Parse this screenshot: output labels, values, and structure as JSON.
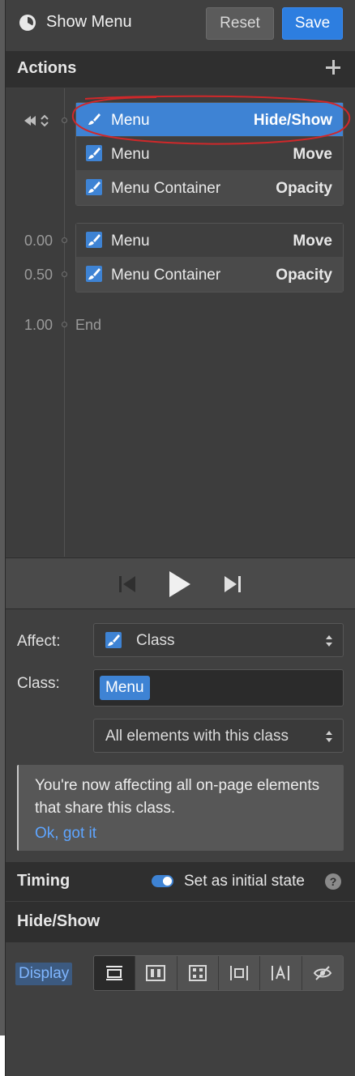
{
  "header": {
    "title": "Show Menu",
    "icon": "clock-icon",
    "reset_label": "Reset",
    "save_label": "Save"
  },
  "actions": {
    "title": "Actions",
    "add_icon": "plus-icon",
    "groups": [
      {
        "time": "",
        "rows": [
          {
            "target": "Menu",
            "action": "Hide/Show",
            "icon": "brush-icon",
            "selected": true
          },
          {
            "target": "Menu",
            "action": "Move",
            "icon": "brush-icon"
          },
          {
            "target": "Menu Container",
            "action": "Opacity",
            "icon": "brush-icon"
          }
        ]
      },
      {
        "rows": [
          {
            "target": "Menu",
            "action": "Move",
            "icon": "brush-icon"
          },
          {
            "target": "Menu Container",
            "action": "Opacity",
            "icon": "brush-icon"
          }
        ]
      }
    ],
    "times": [
      "0.00",
      "0.50",
      "1.00"
    ],
    "end_label": "End"
  },
  "playback": {
    "prev_icon": "skip-back-icon",
    "play_icon": "play-icon",
    "next_icon": "skip-forward-icon"
  },
  "settings": {
    "affect_label": "Affect:",
    "affect_value": "Class",
    "class_label": "Class:",
    "class_chip": "Menu",
    "scope_value": "All elements with this class",
    "notice_text": "You're now affecting all on-page elements that share this class.",
    "notice_link": "Ok, got it"
  },
  "timing": {
    "title": "Timing",
    "initial_state_label": "Set as initial state",
    "initial_state_on": true,
    "help": "?"
  },
  "hide_show": {
    "title": "Hide/Show",
    "display_label": "Display",
    "display_options": [
      "block-icon",
      "flex-icon",
      "grid-icon",
      "inline-block-icon",
      "inline-icon",
      "none-icon"
    ],
    "active_option": "block-icon"
  },
  "colors": {
    "accent": "#3e83d4",
    "save": "#2d7ee0",
    "annotation": "#d0282a"
  }
}
